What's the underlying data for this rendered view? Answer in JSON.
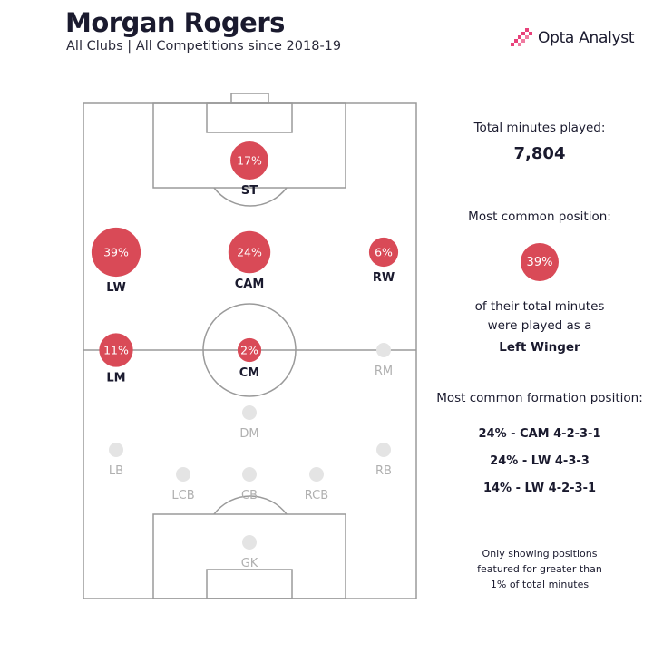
{
  "header": {
    "title": "Morgan Rogers",
    "subtitle": "All Clubs |  All Competitions since 2018-19",
    "brand": "Opta Analyst"
  },
  "side_panel": {
    "minutes_label": "Total minutes played:",
    "minutes_value": "7,804",
    "common_position_label": "Most common position:",
    "common_position_pct": "39%",
    "common_position_line1": "of their total minutes",
    "common_position_line2": "were played as a",
    "common_position_name": "Left Winger",
    "formation_label": "Most common formation position:",
    "formations": [
      "24% - CAM 4-2-3-1",
      "24% - LW 4-3-3",
      "14% - LW 4-2-3-1"
    ],
    "footnote_line1": "Only showing positions",
    "footnote_line2": "featured for greater than",
    "footnote_line3": "1% of total minutes"
  },
  "colors": {
    "active_circle": "#d94a57",
    "inactive_circle": "#e4e4e4",
    "pitch_lines": "#9a9a9a",
    "text_dark": "#1a1a2e",
    "text_muted": "#b0b0b0"
  },
  "chart_data": {
    "type": "pitch-position-map",
    "title": "Morgan Rogers",
    "subtitle": "All Clubs |  All Competitions since 2018-19",
    "unit": "% of total minutes",
    "positions": [
      {
        "label": "ST",
        "value": 17,
        "display": "17%"
      },
      {
        "label": "LW",
        "value": 39,
        "display": "39%"
      },
      {
        "label": "CAM",
        "value": 24,
        "display": "24%"
      },
      {
        "label": "RW",
        "value": 6,
        "display": "6%"
      },
      {
        "label": "LM",
        "value": 11,
        "display": "11%"
      },
      {
        "label": "CM",
        "value": 2,
        "display": "2%"
      },
      {
        "label": "RM",
        "value": 0,
        "display": ""
      },
      {
        "label": "DM",
        "value": 0,
        "display": ""
      },
      {
        "label": "LB",
        "value": 0,
        "display": ""
      },
      {
        "label": "RB",
        "value": 0,
        "display": ""
      },
      {
        "label": "LCB",
        "value": 0,
        "display": ""
      },
      {
        "label": "CB",
        "value": 0,
        "display": ""
      },
      {
        "label": "RCB",
        "value": 0,
        "display": ""
      },
      {
        "label": "GK",
        "value": 0,
        "display": ""
      }
    ]
  }
}
